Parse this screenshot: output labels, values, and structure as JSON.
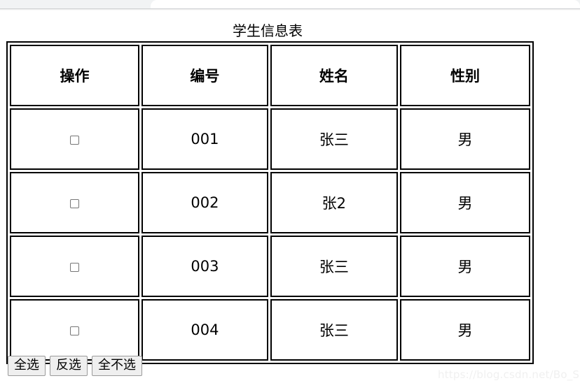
{
  "browser": {
    "tab_strip_color": "#f1f3f4",
    "active_tab_color": "#ffffff"
  },
  "page": {
    "title": "学生信息表",
    "watermark": "https://blog.csdn.net/Bo_Sir",
    "border_color": "#000000",
    "background": "#ffffff"
  },
  "table": {
    "headers": [
      "操作",
      "编号",
      "姓名",
      "性别"
    ],
    "rows": [
      {
        "checked": false,
        "id": "001",
        "name": "张三",
        "gender": "男"
      },
      {
        "checked": false,
        "id": "002",
        "name": "张2",
        "gender": "男"
      },
      {
        "checked": false,
        "id": "003",
        "name": "张三",
        "gender": "男"
      },
      {
        "checked": false,
        "id": "004",
        "name": "张三",
        "gender": "男"
      }
    ]
  },
  "buttons": {
    "select_all": "全选",
    "invert": "反选",
    "deselect_all": "全不选",
    "face_color": "#efefef",
    "border_color": "#9a9a9a"
  }
}
